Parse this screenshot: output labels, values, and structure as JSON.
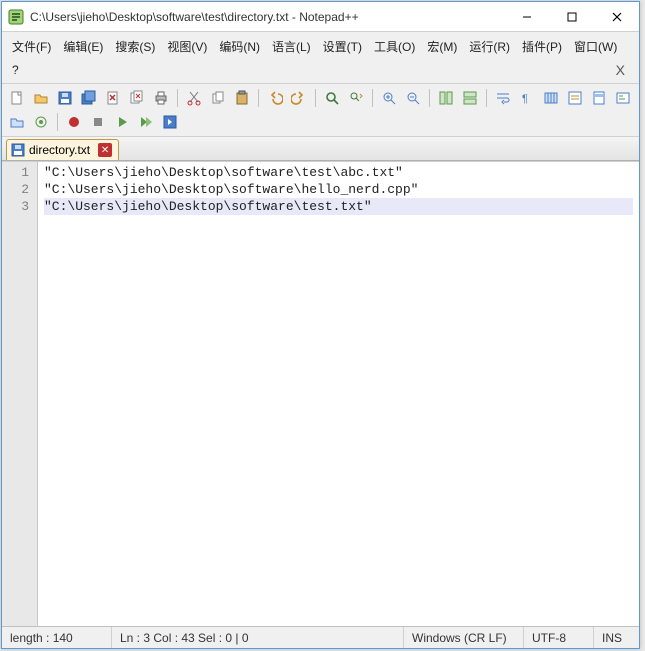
{
  "window": {
    "title": "C:\\Users\\jieho\\Desktop\\software\\test\\directory.txt - Notepad++"
  },
  "menu": {
    "items": [
      "文件(F)",
      "编辑(E)",
      "搜索(S)",
      "视图(V)",
      "编码(N)",
      "语言(L)",
      "设置(T)",
      "工具(O)",
      "宏(M)",
      "运行(R)",
      "插件(P)",
      "窗口(W)",
      "?"
    ],
    "overflow_x": "X"
  },
  "tab": {
    "label": "directory.txt"
  },
  "editor": {
    "lines": [
      "\"C:\\Users\\jieho\\Desktop\\software\\test\\abc.txt\"",
      "\"C:\\Users\\jieho\\Desktop\\software\\hello_nerd.cpp\"",
      "\"C:\\Users\\jieho\\Desktop\\software\\test.txt\""
    ],
    "current_line_index": 2
  },
  "status": {
    "length_label": "length : 140",
    "pos_label": "Ln : 3    Col : 43    Sel : 0 | 0",
    "eol": "Windows (CR LF)",
    "encoding": "UTF-8",
    "insert_mode": "INS"
  }
}
